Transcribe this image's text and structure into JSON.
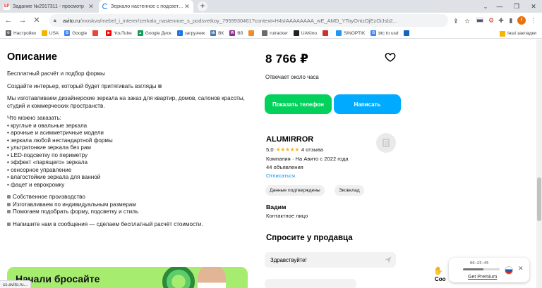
{
  "browser": {
    "tabs": [
      {
        "label": "Задание №2917311 - просмотр",
        "favicon": "SP",
        "active": false
      },
      {
        "label": "Зеркало настенное с подсветкой",
        "active": true
      }
    ],
    "url_host": "avito.ru",
    "url_path": "/moskva/mebel_i_interer/zerkalo_nastennoe_s_podsvetkoy_7959930461?context=H4sIAAAAAAAA_wE_AMD_YToyOntzOjEzOiJsb2...",
    "bookmarks": [
      "Настройки",
      "USA",
      "Google",
      "",
      "YouTube",
      "Google Диск",
      "загрузчик",
      "ВК",
      "Вб",
      "",
      "rutracker",
      "UAKino",
      "",
      "SINOPTIK",
      "btc to usd",
      ""
    ],
    "bookmarks_other": "Інші закладки",
    "status_text": "cs.avito.ru..."
  },
  "listing": {
    "description_title": "Описание",
    "paragraphs": [
      "Бесплатный расчёт и подбор формы",
      "Создайте интерьер, который будет притягивать взгляды",
      "Мы изготавливаем дизайнерские зеркала на заказ для квартир, домов, салонов красоты, студий и коммерческих пространств."
    ],
    "order_heading": "Что можно заказать:",
    "order_items": [
      "• круглые и овальные зеркала",
      "• арочные и асимметричные модели",
      "• зеркала любой нестандартной формы",
      "• ультратонкие зеркала без рам",
      "• LED-подсветку по периметру",
      "• эффект «парящего» зеркала",
      "• сенсорное управление",
      "• влагостойкие зеркала для ванной",
      "• фацет и еврокромку"
    ],
    "features": [
      "Собственное производство",
      "Изготавливаем по индивидуальным размерам",
      "Помогаем подобрать форму, подсветку и стиль"
    ],
    "cta_text": "Напишите нам в сообщения — сделаем бесплатный расчёт стоимости.",
    "banner_text": "Начали бросайте"
  },
  "sidebar": {
    "price": "8 766 ₽",
    "reply_time": "Отвечает около часа",
    "show_phone_label": "Показать телефон",
    "write_label": "Написать",
    "seller_name": "ALUMIRROR",
    "rating": "5,0",
    "reviews": "4 отзыва",
    "company_info": "Компания · На Авито с 2022 года",
    "ads_count": "44 объявления",
    "subscribe_label": "Отписаться",
    "badges": [
      "Данные подтверждены",
      "Эковклад"
    ],
    "contact_name": "Вадим",
    "contact_role": "Контактное лицо",
    "ask_title": "Спросите у продавца",
    "message_value": "Здравствуйте!"
  },
  "recorder": {
    "time": "00:25:45",
    "premium_label": "Get Premium",
    "progress": 0.55,
    "partial_label": "Cоо"
  }
}
